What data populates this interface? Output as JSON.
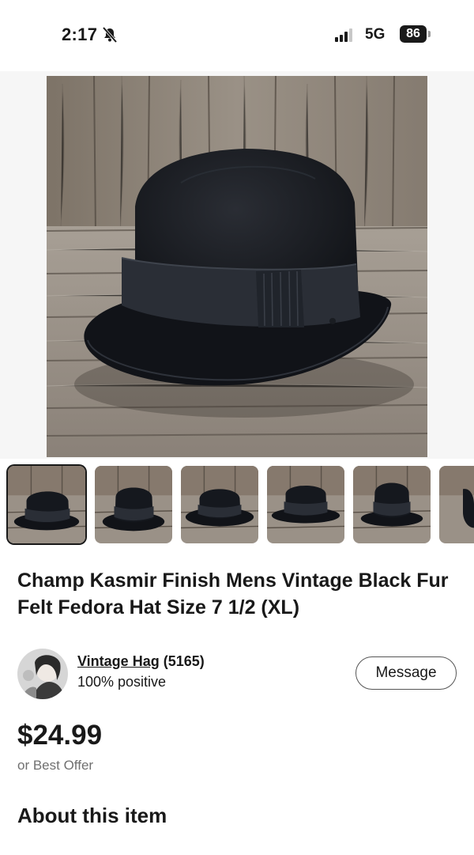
{
  "status_bar": {
    "time": "2:17",
    "network": "5G",
    "battery": "86"
  },
  "listing": {
    "title": "Champ Kasmir Finish Mens Vintage Black Fur Felt Fedora Hat Size 7 1/2 (XL)",
    "price": "$24.99",
    "best_offer": "or Best Offer",
    "about_heading": "About this item"
  },
  "seller": {
    "name": "Vintage Hag",
    "feedback_count": "(5165)",
    "positive": "100% positive",
    "message_label": "Message"
  },
  "gallery": {
    "selected_index": 0,
    "thumbnail_count": 6
  },
  "colors": {
    "text": "#191919",
    "muted": "#707070",
    "hat": "#16181d",
    "wood": "#8f877d"
  }
}
